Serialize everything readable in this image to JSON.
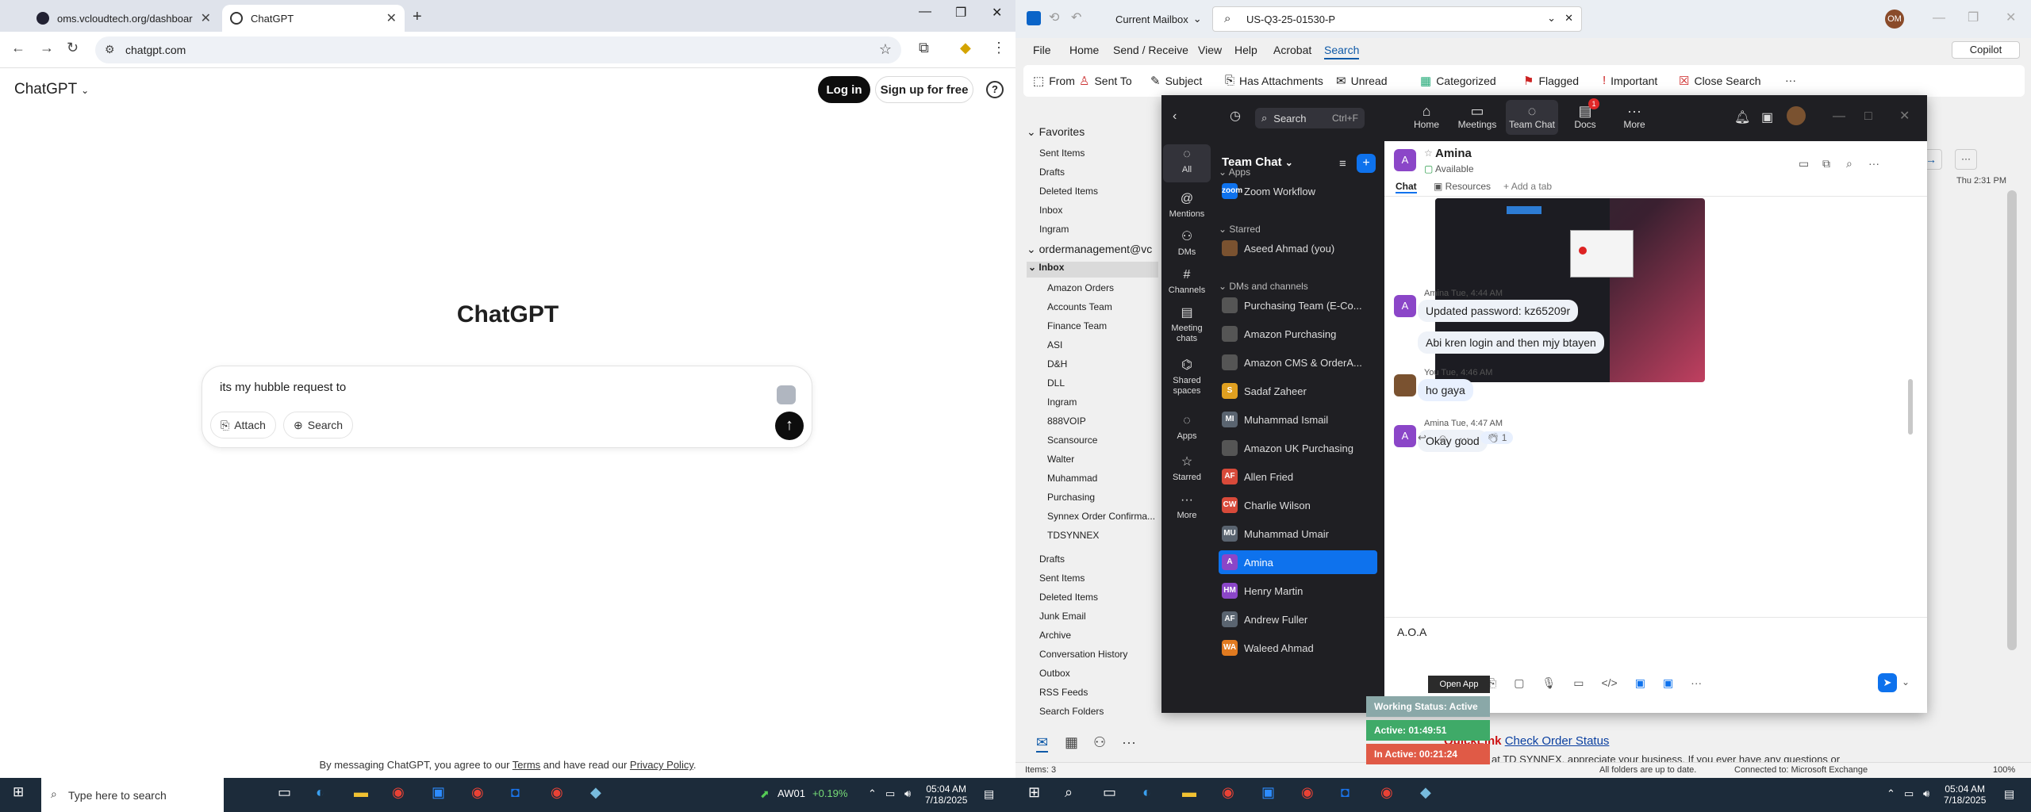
{
  "chrome": {
    "tabs": [
      {
        "title": "oms.vcloudtech.org/dashboard"
      },
      {
        "title": "ChatGPT"
      }
    ],
    "url": "chatgpt.com"
  },
  "chatgpt": {
    "logo": "ChatGPT",
    "login": "Log in",
    "signup": "Sign up for free",
    "help": "?",
    "title": "ChatGPT",
    "input_text": "its my hubble request to",
    "attach": "Attach",
    "search": "Search",
    "footer_pre": "By messaging ChatGPT, you agree to our ",
    "footer_terms": "Terms",
    "footer_mid": " and have read our ",
    "footer_privacy": "Privacy Policy",
    "footer_end": "."
  },
  "outlook": {
    "scope": "Current Mailbox",
    "search_value": "US-Q3-25-01530-P",
    "avatar": "OM",
    "copilot": "Copilot",
    "menu": [
      "File",
      "Home",
      "Send / Receive",
      "View",
      "Help",
      "Acrobat",
      "Search"
    ],
    "ribbon": [
      "From",
      "Sent To",
      "Subject",
      "Has Attachments",
      "Unread",
      "Categorized",
      "Flagged",
      "Important",
      "Close Search"
    ],
    "favorites_label": "Favorites",
    "favorites": [
      "Sent Items",
      "Drafts",
      "Deleted Items",
      "Inbox",
      "Ingram"
    ],
    "account": "ordermanagement@vc",
    "inbox_label": "Inbox",
    "inbox_children": [
      "Amazon Orders",
      "Accounts Team",
      "Finance Team",
      "ASI",
      "D&H",
      "DLL",
      "Ingram",
      "888VOIP",
      "Scansource",
      "Walter",
      "Muhammad",
      "Purchasing",
      "Synnex Order Confirma...",
      "TDSYNNEX"
    ],
    "other_folders": [
      "Drafts",
      "Sent Items",
      "Deleted Items",
      "Junk Email",
      "Archive",
      "Conversation History",
      "Outbox",
      "RSS Feeds",
      "Search Folders"
    ],
    "reading_date": "Thu 2:31 PM",
    "status_items": "Items: 3",
    "status_sync": "All folders are up to date.",
    "status_conn": "Connected to: Microsoft Exchange",
    "zoom_level": "100%",
    "mail_quicklink_a": "QuickLink",
    "mail_quicklink_b": "Check Order Status",
    "mail_line": "at TD SYNNEX, appreciate your business. If you ever have any questions or"
  },
  "zoom": {
    "search": "Search",
    "search_kb": "Ctrl+F",
    "topnav": [
      "Home",
      "Meetings",
      "Team Chat",
      "Docs",
      "More"
    ],
    "docs_badge": "1",
    "rail": [
      "All",
      "Mentions",
      "DMs",
      "Channels",
      "Meeting chats",
      "Shared spaces",
      "Apps",
      "Starred",
      "More"
    ],
    "list_title": "Team Chat",
    "sec_apps": "Apps",
    "sec_starred": "Starred",
    "sec_dms": "DMs and channels",
    "apps": [
      {
        "name": "Zoom Workflow",
        "av": "zoom",
        "color": "#0e72ed"
      }
    ],
    "starred": [
      {
        "name": "Aseed Ahmad (you)",
        "av": "",
        "color": "#7a5230"
      }
    ],
    "channels": [
      {
        "name": "Purchasing Team (E-Co...",
        "av": "",
        "color": "#555"
      },
      {
        "name": "Amazon Purchasing",
        "av": "",
        "color": "#555"
      },
      {
        "name": "Amazon CMS & OrderA...",
        "av": "",
        "color": "#555"
      },
      {
        "name": "Sadaf Zaheer",
        "av": "S",
        "color": "#e0a020"
      },
      {
        "name": "Muhammad Ismail",
        "av": "MI",
        "color": "#5a6470"
      },
      {
        "name": "Amazon UK Purchasing",
        "av": "",
        "color": "#555"
      },
      {
        "name": "Allen Fried",
        "av": "AF",
        "color": "#d84a3a"
      },
      {
        "name": "Charlie Wilson",
        "av": "CW",
        "color": "#d84a3a"
      },
      {
        "name": "Muhammad Umair",
        "av": "MU",
        "color": "#5a6470"
      },
      {
        "name": "Amina",
        "av": "A",
        "color": "#8b46c8"
      },
      {
        "name": "Henry Martin",
        "av": "HM",
        "color": "#8b46c8"
      },
      {
        "name": "Andrew Fuller",
        "av": "AF",
        "color": "#5a6470"
      },
      {
        "name": "Waleed Ahmad",
        "av": "WA",
        "color": "#e07a20"
      }
    ],
    "chat_name": "Amina",
    "chat_status": "Available",
    "tabs": [
      "Chat",
      "Resources",
      "Add a tab"
    ],
    "messages": [
      {
        "meta": "Amina Tue, 4:44 AM",
        "lines": [
          "Updated password: kz65209r",
          "Abi kren login and then mjy btayen"
        ]
      },
      {
        "meta": "You Tue, 4:46 AM",
        "lines": [
          "ho gaya"
        ]
      },
      {
        "meta": "Amina Tue, 4:47 AM",
        "lines": [
          "Okay good"
        ]
      }
    ],
    "reaction_count": "1",
    "compose_text": "A.O.A",
    "avatar_letter": "A"
  },
  "widget": {
    "open_app": "Open App",
    "working": "Working Status: Active",
    "active": "Active: 01:49:51",
    "inactive": "In Active: 00:21:24"
  },
  "taskbars": {
    "search_placeholder": "Type here to search",
    "stock_name": "AW01",
    "stock_change": "+0.19%",
    "time": "05:04 AM",
    "date": "7/18/2025"
  }
}
